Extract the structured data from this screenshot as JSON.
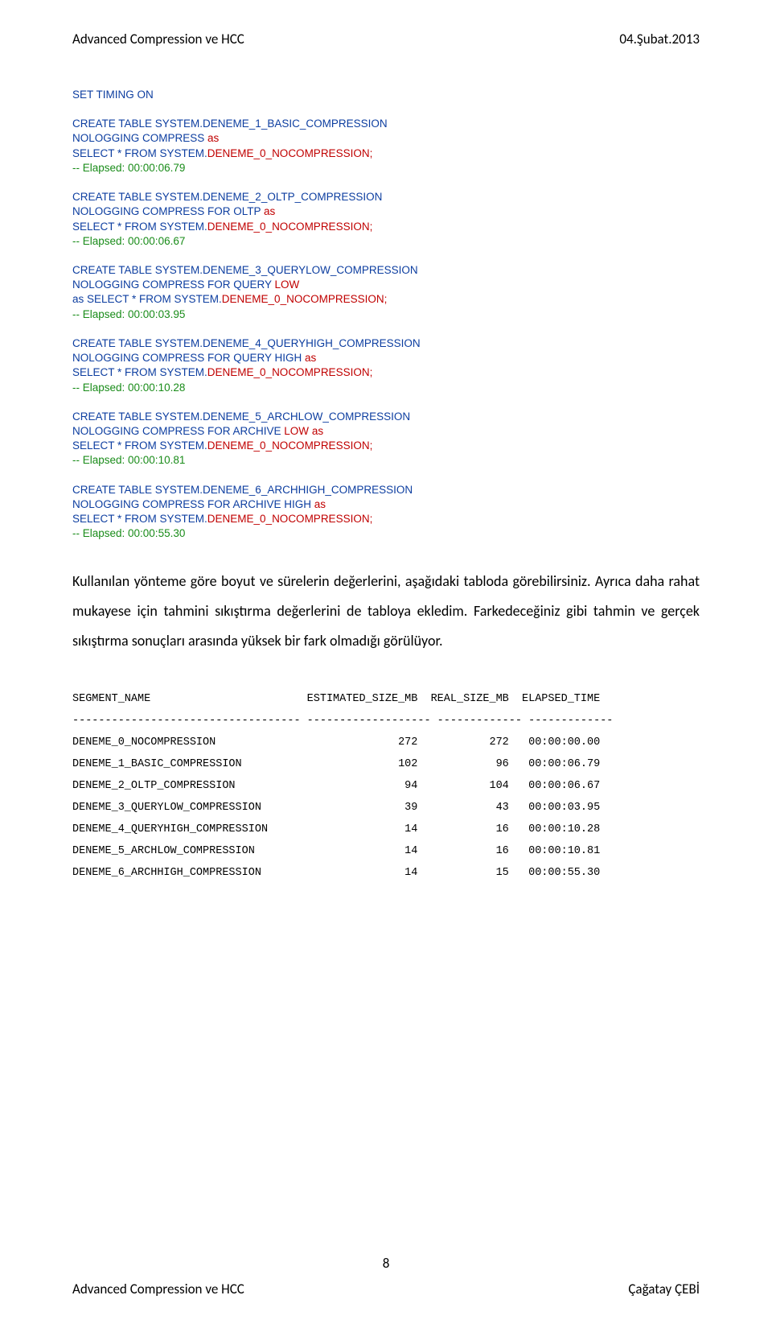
{
  "header": {
    "left": "Advanced Compression ve HCC",
    "right": "04.Şubat.2013"
  },
  "code": {
    "timing": "SET TIMING ON",
    "g1": {
      "l1": "CREATE TABLE SYSTEM.DENEME_1_BASIC_COMPRESSION",
      "l2a": "NOLOGGING COMPRESS ",
      "l2b": "as",
      "l3a": "SELECT * FROM SYSTEM.",
      "l3b": "DENEME_0_NOCOMPRESSION;",
      "l4": "-- Elapsed: 00:00:06.79"
    },
    "g2": {
      "l1": "CREATE TABLE SYSTEM.DENEME_2_OLTP_COMPRESSION",
      "l2a": "NOLOGGING COMPRESS FOR OLTP ",
      "l2b": "as",
      "l3a": "SELECT * FROM SYSTEM.",
      "l3b": "DENEME_0_NOCOMPRESSION;",
      "l4": "-- Elapsed: 00:00:06.67"
    },
    "g3": {
      "l1": "CREATE TABLE SYSTEM.DENEME_3_QUERYLOW_COMPRESSION",
      "l2a": "NOLOGGING COMPRESS FOR QUERY ",
      "l2b": "LOW",
      "l3a": "as SELECT * FROM SYSTEM.",
      "l3b": "DENEME_0_NOCOMPRESSION;",
      "l4": "-- Elapsed: 00:00:03.95"
    },
    "g4": {
      "l1": "CREATE TABLE SYSTEM.DENEME_4_QUERYHIGH_COMPRESSION",
      "l2a": "NOLOGGING COMPRESS FOR QUERY HIGH ",
      "l2b": "as",
      "l3a": "SELECT * FROM SYSTEM.",
      "l3b": "DENEME_0_NOCOMPRESSION;",
      "l4": "-- Elapsed: 00:00:10.28"
    },
    "g5": {
      "l1": "CREATE TABLE SYSTEM.DENEME_5_ARCHLOW_COMPRESSION",
      "l2a": "NOLOGGING COMPRESS FOR ARCHIVE ",
      "l2b": "LOW ",
      "l2c": "as",
      "l3a": "SELECT * FROM SYSTEM.",
      "l3b": "DENEME_0_NOCOMPRESSION;",
      "l4": "-- Elapsed: 00:00:10.81"
    },
    "g6": {
      "l1": "CREATE TABLE SYSTEM.DENEME_6_ARCHHIGH_COMPRESSION",
      "l2a": "NOLOGGING COMPRESS FOR ARCHIVE HIGH ",
      "l2b": "as",
      "l3a": "SELECT * FROM SYSTEM.",
      "l3b": "DENEME_0_NOCOMPRESSION;",
      "l4": "-- Elapsed: 00:00:55.30"
    }
  },
  "body_text": "Kullanılan yönteme göre boyut ve sürelerin değerlerini, aşağıdaki tabloda görebilirsiniz. Ayrıca daha rahat mukayese için tahmini sıkıştırma değerlerini de tabloya ekledim. Farkedeceğiniz gibi tahmin ve gerçek sıkıştırma sonuçları arasında yüksek bir fark olmadığı  görülüyor.",
  "table_text": "SEGMENT_NAME                        ESTIMATED_SIZE_MB  REAL_SIZE_MB  ELAPSED_TIME\n----------------------------------- ------------------- ------------- -------------\nDENEME_0_NOCOMPRESSION                            272           272   00:00:00.00\nDENEME_1_BASIC_COMPRESSION                        102            96   00:00:06.79\nDENEME_2_OLTP_COMPRESSION                          94           104   00:00:06.67\nDENEME_3_QUERYLOW_COMPRESSION                      39            43   00:00:03.95\nDENEME_4_QUERYHIGH_COMPRESSION                     14            16   00:00:10.28\nDENEME_5_ARCHLOW_COMPRESSION                       14            16   00:00:10.81\nDENEME_6_ARCHHIGH_COMPRESSION                      14            15   00:00:55.30",
  "page_number": "8",
  "footer": {
    "left": "Advanced Compression ve HCC",
    "right": "Çağatay ÇEBİ"
  }
}
